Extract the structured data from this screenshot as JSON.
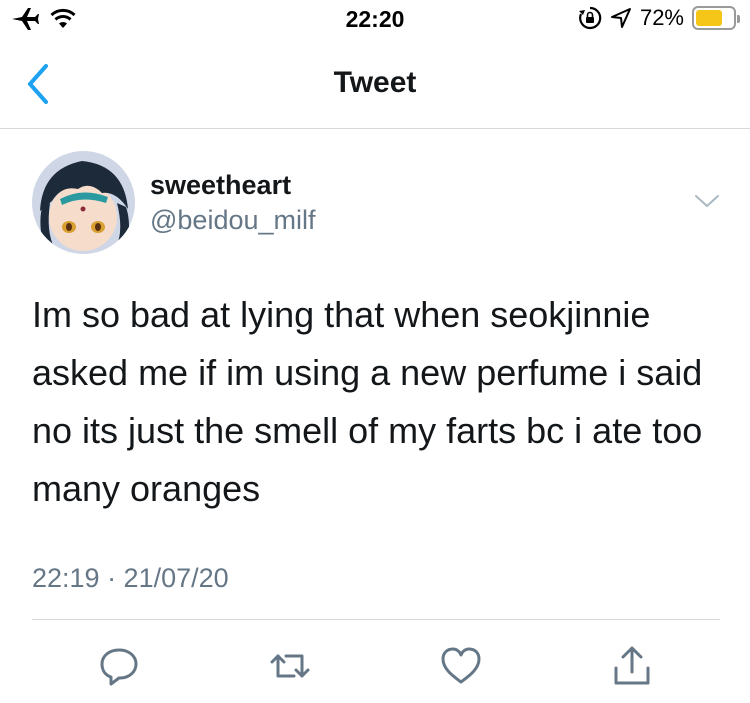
{
  "status_bar": {
    "time": "22:20",
    "battery_percent": "72%",
    "battery_level": 0.72,
    "icons": [
      "airplane-icon",
      "wifi-icon",
      "rotation-lock-icon",
      "location-icon",
      "battery-icon"
    ],
    "battery_color": "#f5c518"
  },
  "nav": {
    "title": "Tweet",
    "back_icon": "chevron-left-icon",
    "accent_color": "#1da1f2"
  },
  "tweet": {
    "author_name": "sweetheart",
    "author_handle": "@beidou_milf",
    "text": "Im so bad at lying that when seokjinnie asked me if im using a new perfume i said no its just the smell of my farts bc i ate too many oranges",
    "timestamp": "22:19 · 21/07/20",
    "menu_icon": "chevron-down-icon"
  },
  "actions": [
    {
      "icon": "reply-icon"
    },
    {
      "icon": "retweet-icon"
    },
    {
      "icon": "like-icon"
    },
    {
      "icon": "share-icon"
    }
  ],
  "colors": {
    "text_primary": "#14171a",
    "text_secondary": "#657786",
    "divider": "#d6d9db",
    "icon_gray": "#657786"
  }
}
